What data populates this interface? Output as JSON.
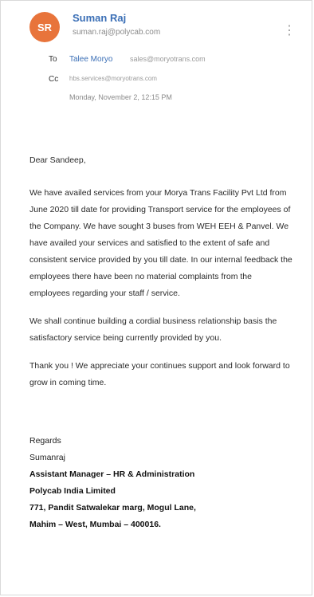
{
  "sender": {
    "initials": "SR",
    "name": "Suman Raj",
    "email": "suman.raj@polycab.com"
  },
  "recipients": {
    "to_label": "To",
    "to_name": "Talee Moryo",
    "to_email": "sales@moryotrans.com",
    "cc_label": "Cc",
    "cc_email": "hbs.services@moryotrans.com"
  },
  "date": "Monday, November 2, 12:15 PM",
  "body": {
    "greeting": "Dear Sandeep,",
    "paragraphs": [
      "We have availed services from your Morya Trans Facility Pvt Ltd from June 2020 till date for providing Transport service for the employees of the Company. We have sought 3 buses from WEH EEH & Panvel. We have availed your services and satisfied to the extent of safe and consistent service provided by you till date. In our internal feedback the employees there have been no material complaints from the employees regarding your staff / service.",
      "We shall continue building a cordial business relationship basis the satisfactory service being currently provided by you.",
      "Thank you ! We appreciate your continues support and look forward to grow in coming time."
    ]
  },
  "signature": {
    "regards": "Regards",
    "name": "Sumanraj",
    "title": "Assistant Manager – HR & Administration",
    "company": "Polycab India Limited",
    "address1": "771, Pandit Satwalekar marg, Mogul Lane,",
    "address2": "Mahim – West, Mumbai – 400016."
  }
}
